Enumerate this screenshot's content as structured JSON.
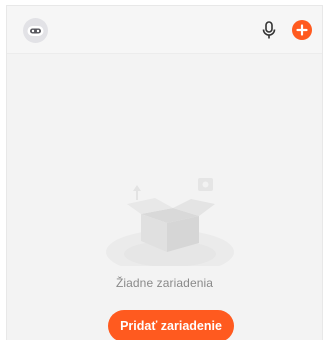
{
  "header": {
    "avatar_icon": "robot-avatar-icon",
    "mic_icon": "microphone-icon",
    "add_icon": "plus-circle-icon"
  },
  "empty_state": {
    "illustration_icon": "empty-box-icon",
    "message": "Žiadne zariadenia",
    "button_label": "Pridať zariadenie"
  },
  "colors": {
    "accent": "#ff5a1f",
    "background": "#f3f3f3",
    "muted_text": "#8a8a8a"
  }
}
